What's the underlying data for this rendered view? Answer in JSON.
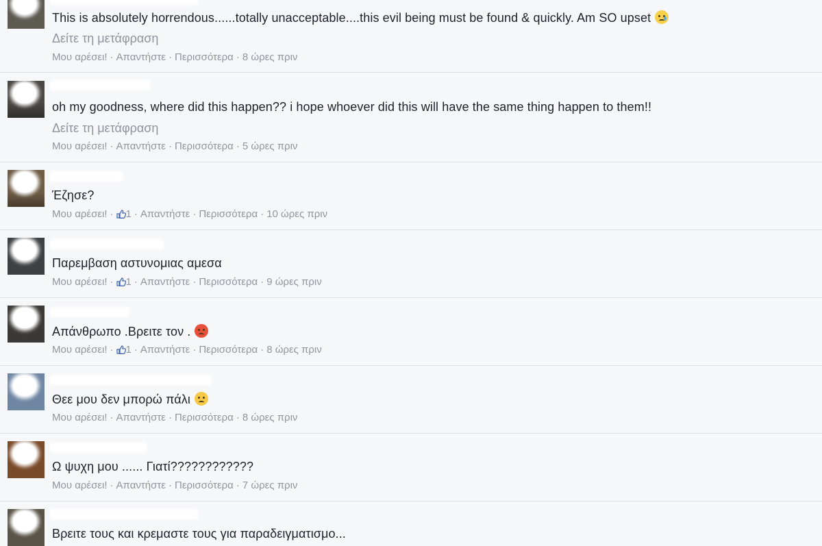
{
  "actions": {
    "like": "Μου αρέσει!",
    "reply": "Απαντήστε",
    "more": "Περισσότερα",
    "separator": "·"
  },
  "comments": [
    {
      "text": "This is absolutely horrendous......totally unacceptable....this evil being must be found & quickly. Am SO upset",
      "emoji": "crying-face-icon",
      "translate": "Δείτε τη μετάφραση",
      "time": "8 ώρες πριν"
    },
    {
      "text": "oh my goodness, where did this happen?? i hope whoever did this will have the same thing happen to them!!",
      "translate": "Δείτε τη μετάφραση",
      "time": "5 ώρες πριν"
    },
    {
      "text": "Έζησε?",
      "likes": "1",
      "time": "10 ώρες πριν"
    },
    {
      "text": "Παρεμβαση αστυνομιας αμεσα",
      "likes": "1",
      "time": "9 ώρες πριν"
    },
    {
      "text": "Απάνθρωπο .Βρειτε τον .",
      "emoji": "angry-face-icon",
      "likes": "1",
      "time": "8 ώρες πριν"
    },
    {
      "text": "Θεε μου δεν μπορώ πάλι",
      "emoji": "worried-face-icon",
      "time": "8 ώρες πριν"
    },
    {
      "text": "Ω ψυχη μου ...... Γιατί????????????",
      "time": "7 ώρες πριν"
    },
    {
      "text": "Βρειτε τους και κρεμαστε τους για παραδειγματισμο..."
    }
  ],
  "colors": {
    "background": "#f6f7f9",
    "text": "#1d2129",
    "meta": "#90949c",
    "divider": "#dddfe2"
  }
}
